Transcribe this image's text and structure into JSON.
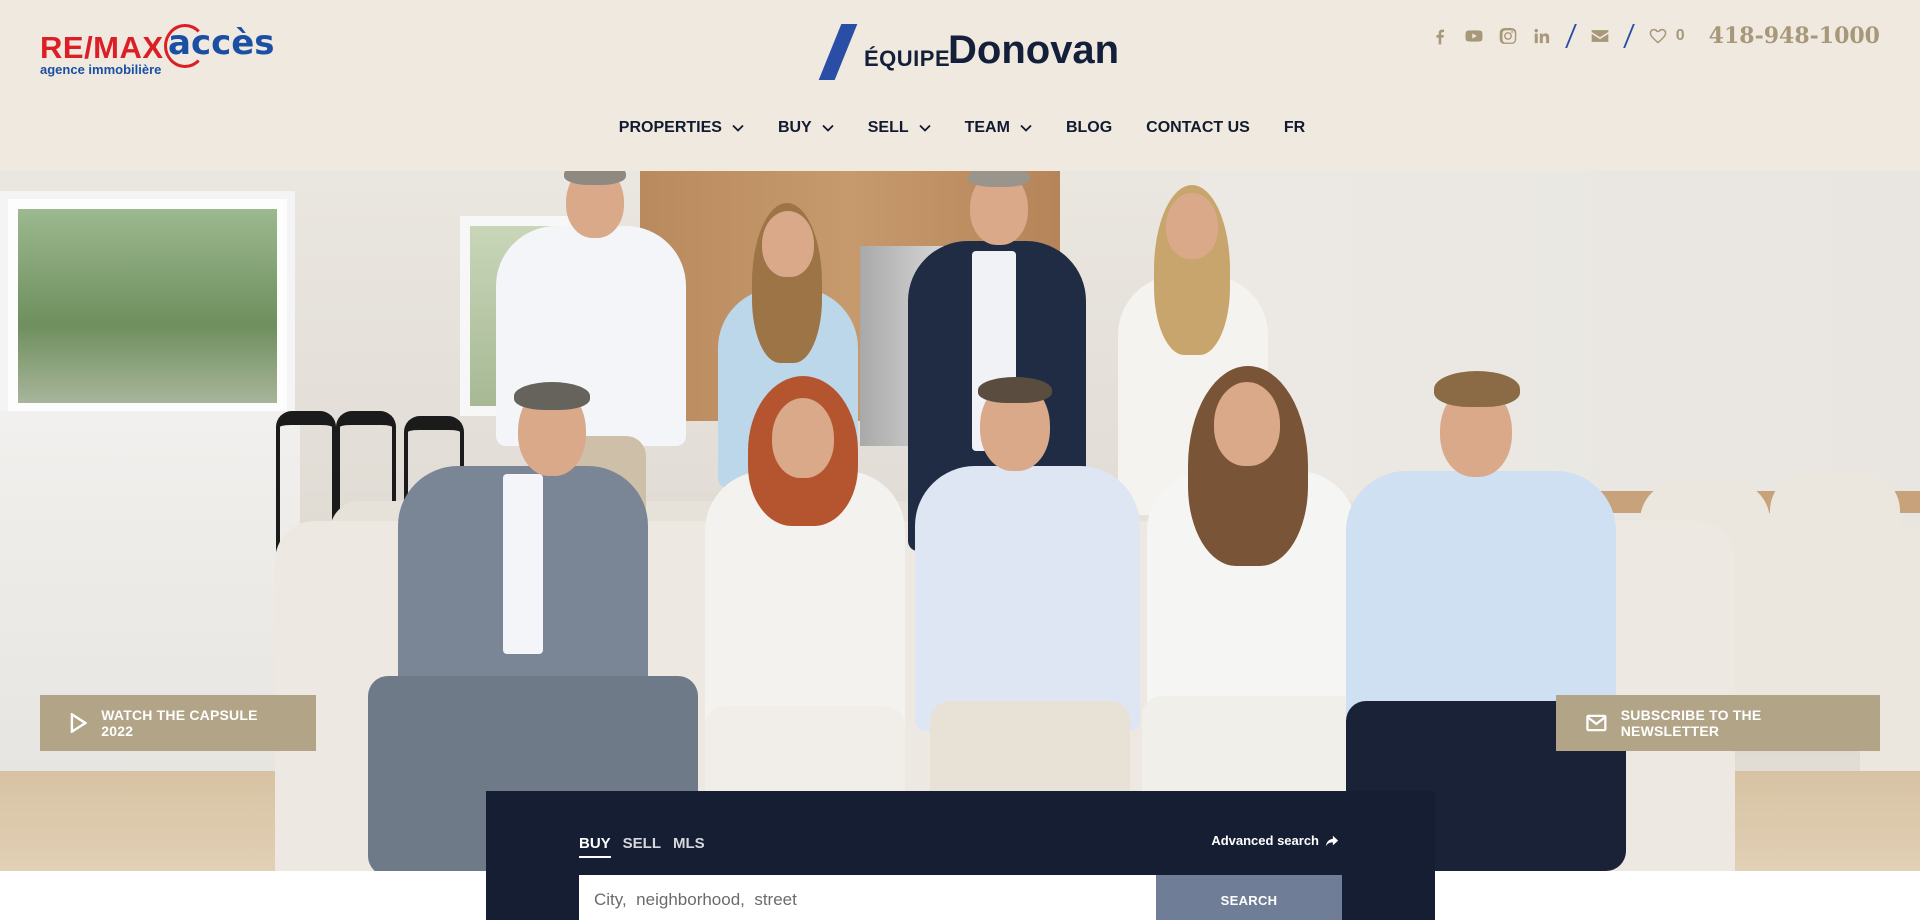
{
  "brand": {
    "agency_primary": "RE/MAX",
    "agency_secondary": "accès",
    "agency_tagline": "agence immobilière",
    "team_prefix": "ÉQUIPE",
    "team_name": "Donovan"
  },
  "top_bar": {
    "social_icons": [
      "facebook-icon",
      "youtube-icon",
      "instagram-icon",
      "linkedin-icon"
    ],
    "mail_icon": "mail-icon",
    "favorites_icon": "heart-icon",
    "favorites_count": "0",
    "phone": "418-948-1000"
  },
  "nav": {
    "items": [
      {
        "label": "PROPERTIES",
        "has_dropdown": true
      },
      {
        "label": "BUY",
        "has_dropdown": true
      },
      {
        "label": "SELL",
        "has_dropdown": true
      },
      {
        "label": "TEAM",
        "has_dropdown": true
      },
      {
        "label": "BLOG",
        "has_dropdown": false
      },
      {
        "label": "CONTACT US",
        "has_dropdown": false
      },
      {
        "label": "FR",
        "has_dropdown": false
      }
    ]
  },
  "hero": {
    "watch_label": "WATCH THE CAPSULE 2022",
    "newsletter_label": "SUBSCRIBE TO THE NEWSLETTER"
  },
  "search": {
    "tabs": [
      {
        "label": "BUY",
        "active": true
      },
      {
        "label": "SELL",
        "active": false
      },
      {
        "label": "MLS",
        "active": false
      }
    ],
    "advanced_label": "Advanced search",
    "placeholder": "City,  neighborhood,  street",
    "button_label": "SEARCH"
  },
  "colors": {
    "header_bg": "#f0e9e0",
    "accent_tan": "#b2a487",
    "navy": "#151e33",
    "brand_blue": "#2a4ea6",
    "remax_red": "#dc1f26"
  }
}
